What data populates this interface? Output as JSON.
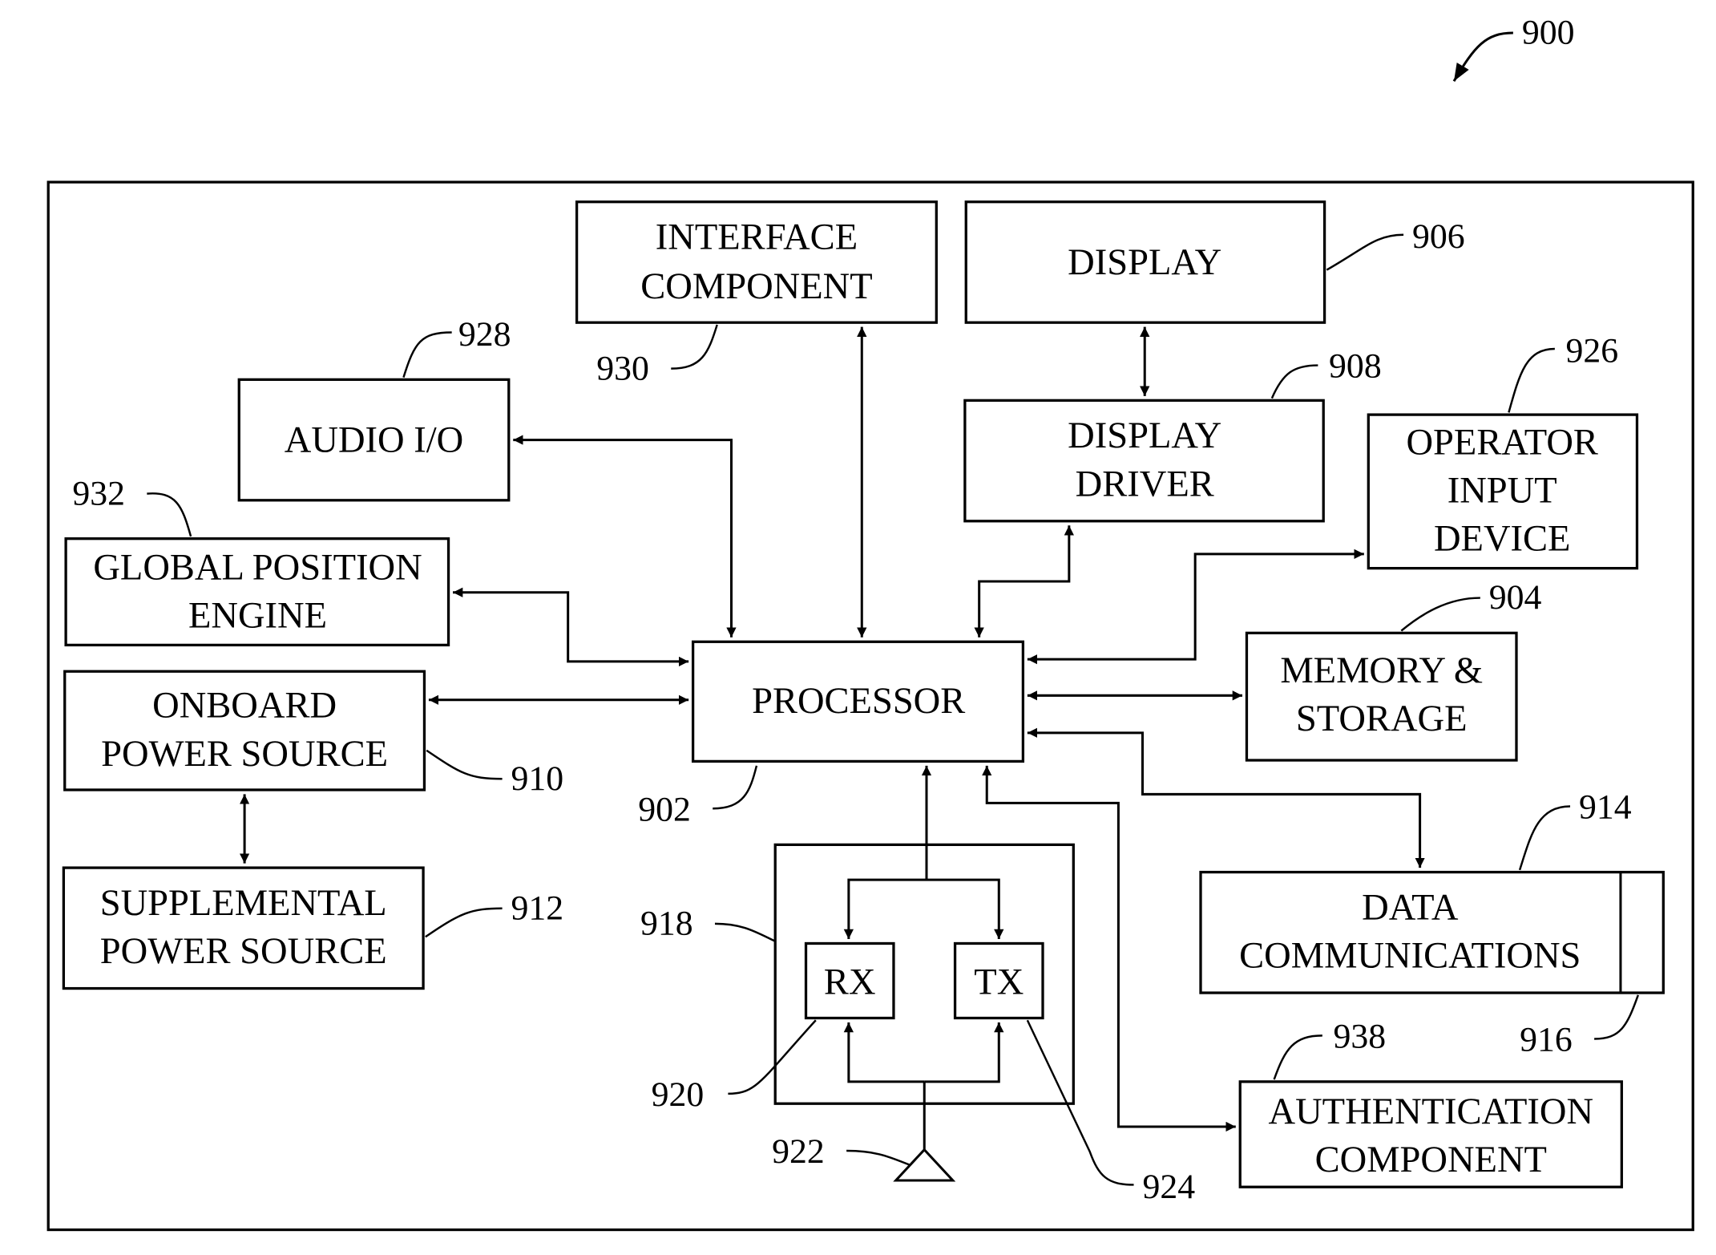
{
  "figure": {
    "ref": "900",
    "components": {
      "interface": {
        "ref": "930",
        "lines": [
          "INTERFACE",
          "COMPONENT"
        ]
      },
      "display": {
        "ref": "906",
        "lines": [
          "DISPLAY"
        ]
      },
      "display_driver": {
        "ref": "908",
        "lines": [
          "DISPLAY",
          "DRIVER"
        ]
      },
      "audio": {
        "ref": "928",
        "lines": [
          "AUDIO I/O"
        ]
      },
      "operator_input": {
        "ref": "926",
        "lines": [
          "OPERATOR",
          "INPUT",
          "DEVICE"
        ]
      },
      "gps": {
        "ref": "932",
        "lines": [
          "GLOBAL POSITION",
          "ENGINE"
        ]
      },
      "memory": {
        "ref": "904",
        "lines": [
          "MEMORY &",
          "STORAGE"
        ]
      },
      "processor": {
        "ref": "902",
        "lines": [
          "PROCESSOR"
        ]
      },
      "onboard_power": {
        "ref": "910",
        "lines": [
          "ONBOARD",
          "POWER SOURCE"
        ]
      },
      "supplemental_power": {
        "ref": "912",
        "lines": [
          "SUPPLEMENTAL",
          "POWER SOURCE"
        ]
      },
      "data_comm": {
        "ref": "914",
        "port_ref": "916",
        "lines": [
          "DATA",
          "COMMUNICATIONS"
        ]
      },
      "transceiver": {
        "ref": "918"
      },
      "rx": {
        "ref": "920",
        "lines": [
          "RX"
        ]
      },
      "tx": {
        "ref": "924",
        "lines": [
          "TX"
        ]
      },
      "antenna": {
        "ref": "922"
      },
      "authentication": {
        "ref": "938",
        "lines": [
          "AUTHENTICATION",
          "COMPONENT"
        ]
      }
    }
  }
}
